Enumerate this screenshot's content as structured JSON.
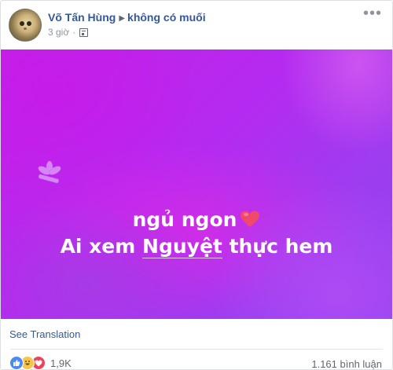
{
  "post": {
    "author": "Võ Tấn Hùng",
    "feeling_target": "không có muối",
    "time": "3 giờ",
    "separator": "·",
    "menu_label": "•••"
  },
  "content": {
    "line1": "ngủ ngon",
    "line2_prefix": "Ai xem ",
    "line2_mention": "Nguyệt",
    "line2_suffix": " thực hem",
    "bg_colors": [
      "#c51fe6",
      "#9d3df0",
      "#eb28e1"
    ]
  },
  "footer": {
    "see_translation": "See Translation",
    "reaction_count": "1,9K",
    "comments": "1.161 bình luận",
    "reactions": [
      "like-icon",
      "haha-icon",
      "love-icon"
    ]
  }
}
